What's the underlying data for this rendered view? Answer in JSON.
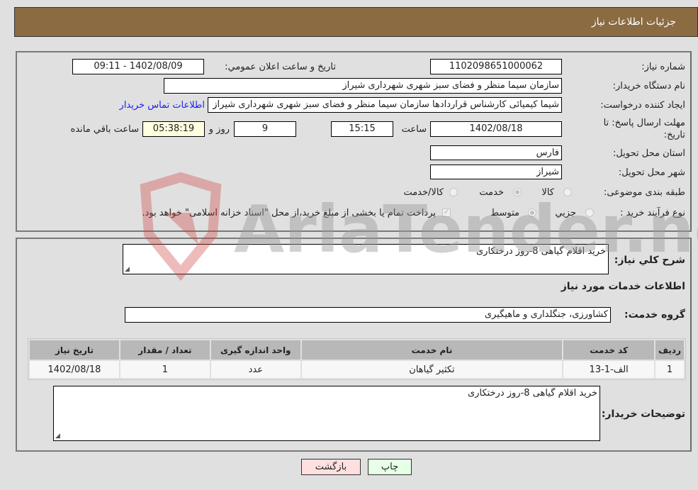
{
  "header": {
    "title": "جزئیات اطلاعات نیاز"
  },
  "details": {
    "need_number": {
      "label": "شماره نیاز:",
      "value": "1102098651000062"
    },
    "announce_datetime": {
      "label": "تاریخ و ساعت اعلان عمومي:",
      "value": "1402/08/09 - 09:11"
    },
    "buyer_org": {
      "label": "نام دستگاه خريدار:",
      "value": "سازمان سیما منظر و فضای سبز شهری شهرداری شیراز"
    },
    "requester": {
      "label": "ايجاد كننده درخواست:",
      "value": "شیما کیمیائی کارشناس قراردادها سازمان سیما منظر و فضای سبز شهری شهرداری شیراز",
      "contact_link": "اطلاعات تماس خريدار"
    },
    "deadline": {
      "label_line1": "مهلت ارسال پاسخ: تا",
      "label_line2": "تاريخ:",
      "date": "1402/08/18",
      "time_label": "ساعت",
      "time": "15:15",
      "days": "9",
      "days_label": "روز و",
      "remaining": "05:38:19",
      "remaining_label": "ساعت باقي مانده"
    },
    "province": {
      "label": "استان محل تحويل:",
      "value": "فارس"
    },
    "city": {
      "label": "شهر محل تحويل:",
      "value": "شیراز"
    },
    "category": {
      "label": "طبقه بندی موضوعی:",
      "options": [
        {
          "label": "كالا",
          "selected": false
        },
        {
          "label": "خدمت",
          "selected": true
        },
        {
          "label": "كالا/خدمت",
          "selected": false
        }
      ]
    },
    "purchase_type": {
      "label": "نوع فرآيند خريد :",
      "options": [
        {
          "label": "جزيي",
          "selected": false
        },
        {
          "label": "متوسط",
          "selected": true
        }
      ],
      "treasury_checkbox": {
        "checked": true,
        "label": "پرداخت تمام یا بخشی از مبلغ خرید،از محل \"اسناد خزانه اسلامی\" خواهد بود."
      }
    }
  },
  "summary": {
    "general_desc": {
      "label": "شرح كلي نياز:",
      "value": "خرید اقلام گیاهی 8-روز درختکاری"
    },
    "services_heading": "اطلاعات خدمات مورد نياز",
    "service_group": {
      "label": "گروه خدمت:",
      "value": "کشاورزی، جنگلداری و ماهیگیری"
    },
    "table": {
      "columns": [
        "رديف",
        "كد خدمت",
        "نام خدمت",
        "واحد اندازه گيری",
        "تعداد / مقدار",
        "تاريخ نياز"
      ],
      "rows": [
        [
          "1",
          "الف-1-13",
          "تکثیر گیاهان",
          "عدد",
          "1",
          "1402/08/18"
        ]
      ]
    },
    "buyer_notes": {
      "label": "توضيحات خريدار:",
      "value": "خرید اقلام گیاهی 8-روز درختکاری"
    }
  },
  "buttons": {
    "print": "چاپ",
    "back": "بازگشت"
  },
  "watermark": {
    "text": "AriaTender.neT"
  },
  "colors": {
    "header_bg": "#8b6b42",
    "page_bg": "#e0e0e0",
    "link": "#1a1aff",
    "print_bg": "#e6ffe6",
    "back_bg": "#ffe0e0",
    "remaining_bg": "#ffffe0"
  }
}
